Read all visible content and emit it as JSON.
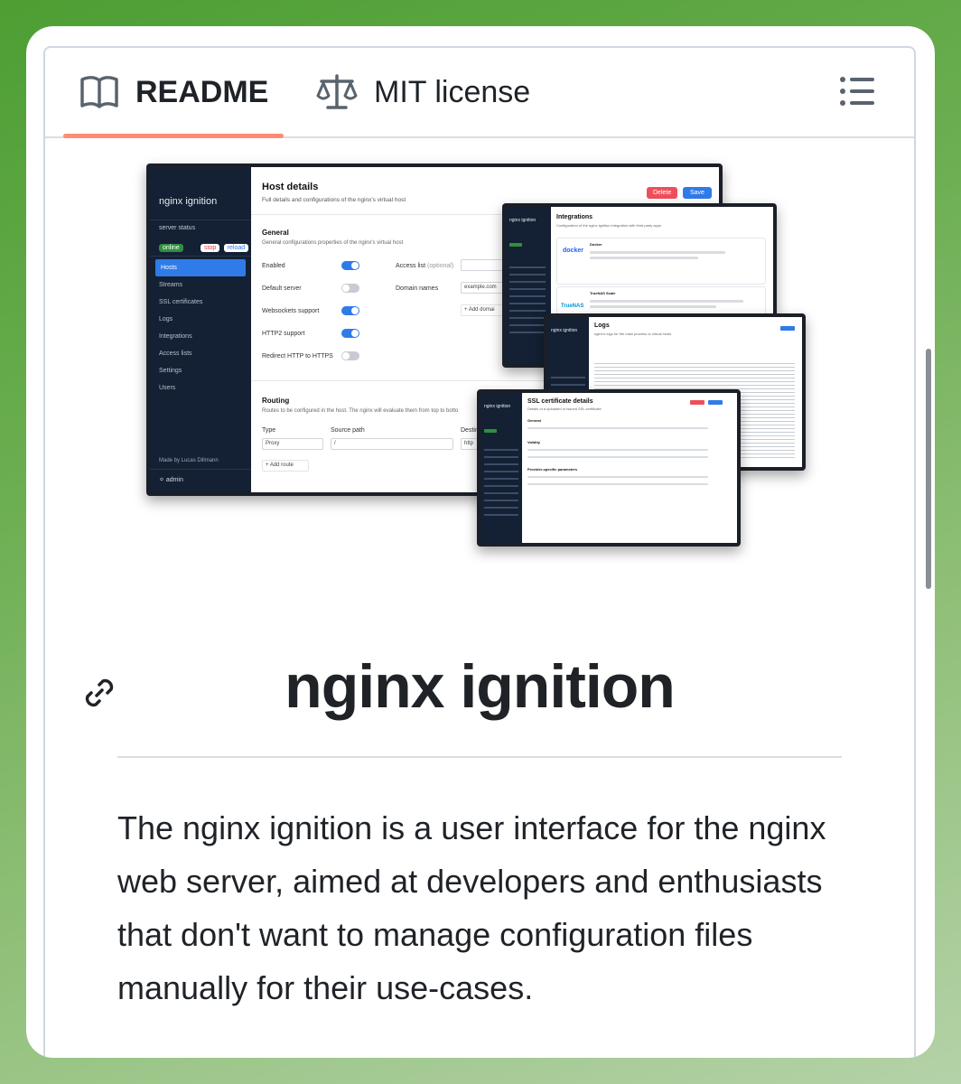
{
  "tabs": {
    "readme": "README",
    "license": "MIT license"
  },
  "mock": {
    "main": {
      "brand": "nginx ignition",
      "server_status": "server status",
      "online": "online",
      "stop": "stop",
      "reload": "reload",
      "nav": [
        "Hosts",
        "Streams",
        "SSL certificates",
        "Logs",
        "Integrations",
        "Access lists",
        "Settings",
        "Users"
      ],
      "made_by": "Made by Lucas Dillmann",
      "user": "admin",
      "title": "Host details",
      "subtitle": "Full details and configurations of the nginx's virtual host",
      "delete": "Delete",
      "save": "Save",
      "general_title": "General",
      "general_sub": "General configurations properties of the nginx's virtual host",
      "enabled": "Enabled",
      "default_server": "Default server",
      "websockets": "Websockets support",
      "http2": "HTTP2 support",
      "redirect": "Redirect HTTP to HTTPS",
      "access_list": "Access list",
      "optional": "(optional)",
      "domain_names": "Domain names",
      "domain_value": "example.com",
      "add_domain": "+ Add domai",
      "routing_title": "Routing",
      "routing_sub": "Routes to be configured in the host. The nginx will evaluate them from top to botto",
      "type": "Type",
      "source_path": "Source path",
      "destination": "Destin",
      "proxy": "Proxy",
      "slash": "/",
      "https": "http",
      "add_route": "+ Add route"
    },
    "integrations": {
      "brand": "nginx ignition",
      "title": "Integrations",
      "subtitle": "Configuration of the nginx ignition integration with third party apps",
      "docker": "Docker",
      "docker_logo": "docker",
      "truenas": "TrueNAS Scale",
      "truenas_logo": "TrueNAS"
    },
    "logs": {
      "brand": "nginx ignition",
      "title": "Logs",
      "subtitle": "nginx's logs for the main process or virtual hosts"
    },
    "ssl": {
      "brand": "nginx ignition",
      "title": "SSL certificate details",
      "subtitle": "Details of a uploaded or issued SSL certificate",
      "general": "General",
      "validity": "Validity",
      "provider": "Provider-specific parameters"
    }
  },
  "heading": "nginx ignition",
  "paragraph": "The nginx ignition is a user interface for the nginx web server, aimed at developers and enthusiasts that don't want to manage configuration files manually for their use-cases."
}
